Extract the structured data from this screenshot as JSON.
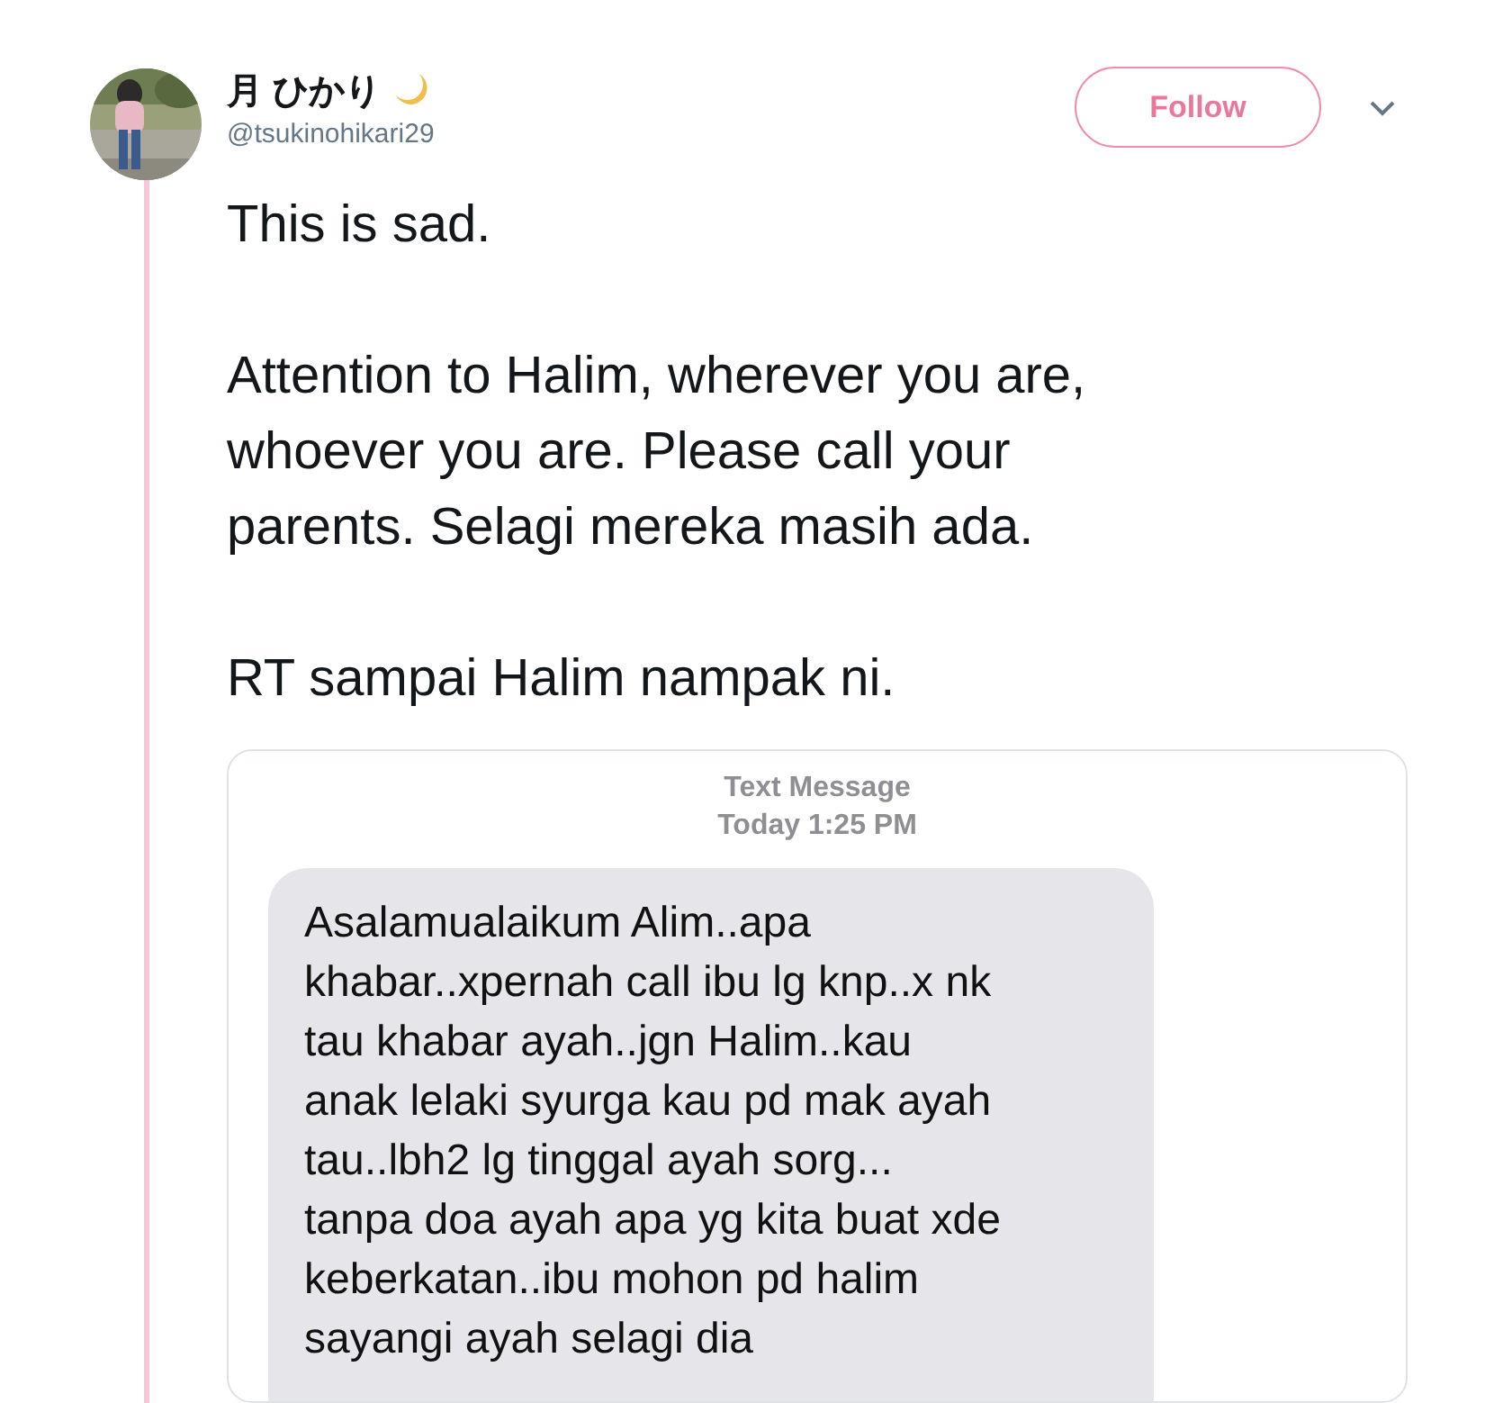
{
  "tweet": {
    "author": {
      "name": "月 ひかり",
      "handle": "@tsukinohikari29"
    },
    "follow_button": "Follow",
    "paragraphs": [
      [
        "This is sad."
      ],
      [
        "Attention to Halim, wherever you are,",
        "whoever you are. Please call your",
        "parents. Selagi mereka masih ada."
      ],
      [
        "RT sampai Halim nampak ni."
      ]
    ],
    "attachment": {
      "header": "Text Message",
      "timestamp": "Today 1:25 PM",
      "message_lines": [
        "Asalamualaikum Alim..apa",
        "khabar..xpernah call ibu lg knp..x nk",
        "tau khabar ayah..jgn Halim..kau",
        "anak lelaki syurga kau pd mak ayah",
        "tau..lbh2 lg tinggal ayah sorg...",
        "tanpa doa ayah apa yg kita buat xde",
        "keberkatan..ibu mohon pd halim",
        "sayangi ayah selagi dia"
      ]
    }
  }
}
